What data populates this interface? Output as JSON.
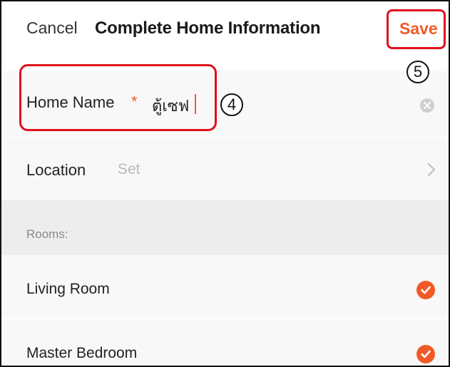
{
  "header": {
    "cancel_label": "Cancel",
    "title": "Complete Home Information",
    "save_label": "Save"
  },
  "form": {
    "home_name_label": "Home Name",
    "required_mark": "*",
    "home_name_value": "ตู้เซฟ",
    "location_label": "Location",
    "location_value": "Set"
  },
  "rooms": {
    "section_label": "Rooms:",
    "items": [
      {
        "label": "Living Room",
        "checked": true
      },
      {
        "label": "Master Bedroom",
        "checked": true
      }
    ]
  },
  "annotations": {
    "step_four": "4",
    "step_five": "5"
  },
  "icons": {
    "clear": "clear-circle-icon",
    "chevron": "chevron-right-icon",
    "check": "checkmark-circle-icon"
  },
  "colors": {
    "accent": "#f05a28",
    "callout": "#e0101a",
    "row_background": "#f8f8f8",
    "section_background": "#ededed"
  }
}
